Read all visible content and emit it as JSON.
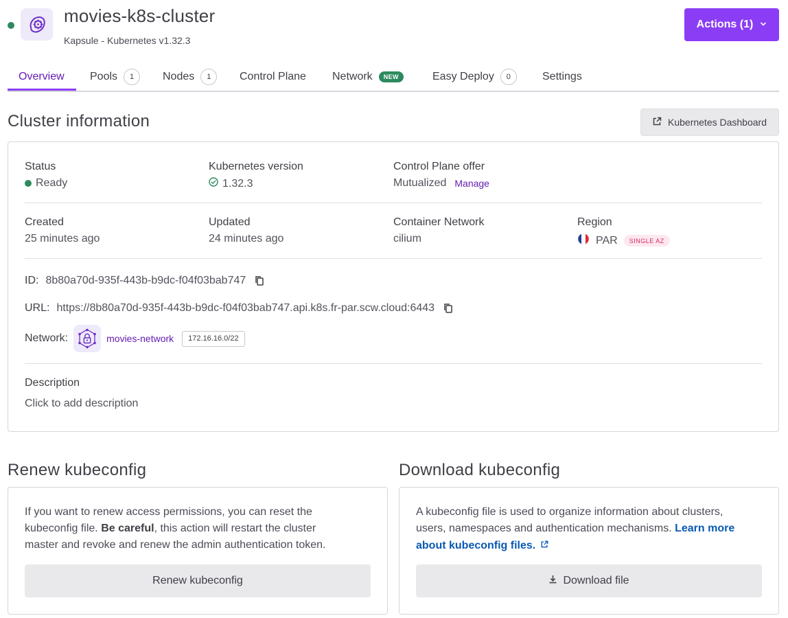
{
  "header": {
    "title": "movies-k8s-cluster",
    "subtitle": "Kapsule - Kubernetes v1.32.3",
    "status_color": "#2d8a5e",
    "icon": "kubernetes-helm-icon",
    "actions_label": "Actions (1)"
  },
  "tabs": [
    {
      "label": "Overview",
      "active": true
    },
    {
      "label": "Pools",
      "count": "1"
    },
    {
      "label": "Nodes",
      "count": "1"
    },
    {
      "label": "Control Plane"
    },
    {
      "label": "Network",
      "badge": "NEW"
    },
    {
      "label": "Easy Deploy",
      "count": "0"
    },
    {
      "label": "Settings"
    }
  ],
  "cluster_info": {
    "title": "Cluster information",
    "dashboard_button": "Kubernetes Dashboard",
    "status_label": "Status",
    "status_value": "Ready",
    "k8s_version_label": "Kubernetes version",
    "k8s_version_value": "1.32.3",
    "control_plane_label": "Control Plane offer",
    "control_plane_value": "Mutualized",
    "manage_link": "Manage",
    "created_label": "Created",
    "created_value": "25 minutes ago",
    "updated_label": "Updated",
    "updated_value": "24 minutes ago",
    "container_network_label": "Container Network",
    "container_network_value": "cilium",
    "region_label": "Region",
    "region_value": "PAR",
    "region_badge": "SINGLE AZ",
    "id_label": "ID:",
    "id_value": "8b80a70d-935f-443b-b9dc-f04f03bab747",
    "url_label": "URL:",
    "url_value": "https://8b80a70d-935f-443b-b9dc-f04f03bab747.api.k8s.fr-par.scw.cloud:6443",
    "network_label": "Network:",
    "network_name": "movies-network",
    "network_cidr": "172.16.16.0/22",
    "description_label": "Description",
    "description_placeholder": "Click to add description"
  },
  "renew": {
    "title": "Renew kubeconfig",
    "text_1": "If you want to renew access permissions, you can reset the",
    "text_2_a": "kubeconfig file.",
    "text_2_b": "Be careful",
    "text_2_c": ", this action will restart the cluster",
    "text_3": "master and revoke and renew the admin authentication token.",
    "button": "Renew kubeconfig"
  },
  "download": {
    "title": "Download kubeconfig",
    "text_1": "A kubeconfig file is used to organize information about clusters,",
    "text_2": "users, namespaces and authentication mechanisms.",
    "link_1": "Learn more",
    "link_2": "about kubeconfig files.",
    "button": "Download file"
  }
}
